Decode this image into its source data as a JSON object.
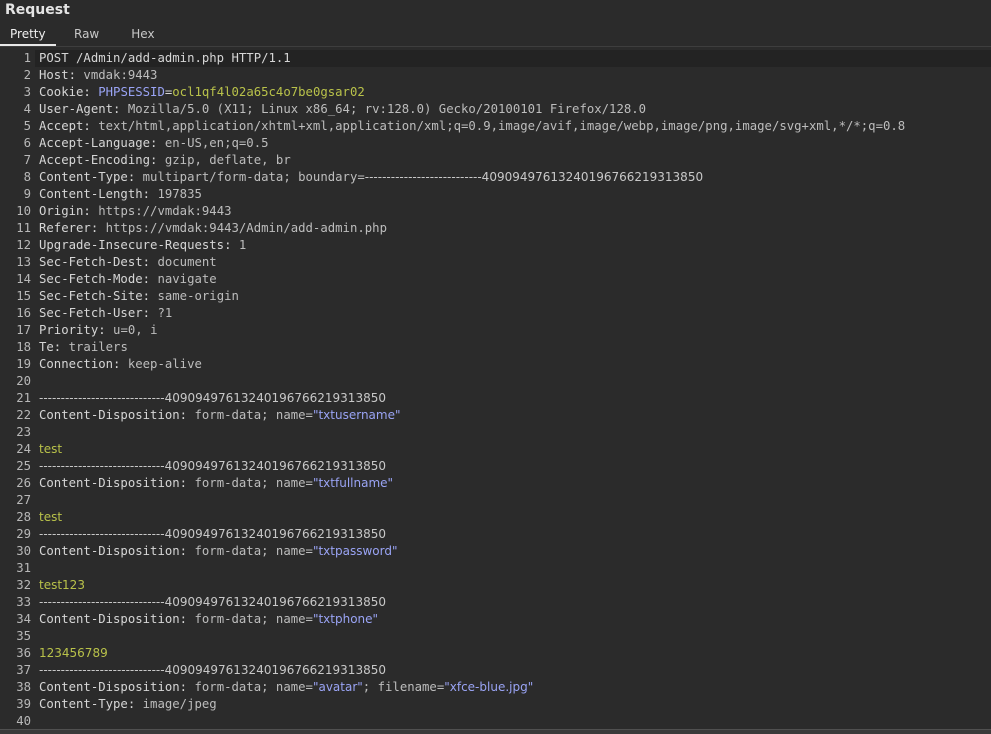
{
  "panel": {
    "title": "Request",
    "tabs": [
      {
        "label": "Pretty",
        "active": true
      },
      {
        "label": "Raw",
        "active": false
      },
      {
        "label": "Hex",
        "active": false
      }
    ]
  },
  "colors": {
    "background": "#2b2b2b",
    "header_name": "#d6d6d6",
    "cookie_name": "#9aa4f5",
    "cookie_value": "#b9c24a",
    "quoted_value": "#9aa4f5",
    "body_value": "#b9c24a"
  },
  "request": {
    "lines": [
      {
        "n": "1",
        "segs": [
          {
            "t": "POST /Admin/add-admin.php HTTP/1.1",
            "c": "hname"
          }
        ]
      },
      {
        "n": "2",
        "segs": [
          {
            "t": "Host: ",
            "c": "hname"
          },
          {
            "t": "vmdak:9443",
            "c": "hval"
          }
        ]
      },
      {
        "n": "3",
        "segs": [
          {
            "t": "Cookie: ",
            "c": "hname"
          },
          {
            "t": "PHPSESSID",
            "c": "cname"
          },
          {
            "t": "=",
            "c": "hname"
          },
          {
            "t": "ocl1qf4l02a65c4o7be0gsar02",
            "c": "cval"
          }
        ]
      },
      {
        "n": "4",
        "segs": [
          {
            "t": "User-Agent: ",
            "c": "hname"
          },
          {
            "t": "Mozilla/5.0 (X11; Linux x86_64; rv:128.0) Gecko/20100101 Firefox/128.0",
            "c": "hval"
          }
        ]
      },
      {
        "n": "5",
        "segs": [
          {
            "t": "Accept: ",
            "c": "hname"
          },
          {
            "t": "text/html,application/xhtml+xml,application/xml;q=0.9,image/avif,image/webp,image/png,image/svg+xml,*/*;q=0.8",
            "c": "hval"
          }
        ]
      },
      {
        "n": "6",
        "segs": [
          {
            "t": "Accept-Language: ",
            "c": "hname"
          },
          {
            "t": "en-US,en;q=0.5",
            "c": "hval"
          }
        ]
      },
      {
        "n": "7",
        "segs": [
          {
            "t": "Accept-Encoding: ",
            "c": "hname"
          },
          {
            "t": "gzip, deflate, br",
            "c": "hval"
          }
        ]
      },
      {
        "n": "8",
        "segs": [
          {
            "t": "Content-Type: ",
            "c": "hname"
          },
          {
            "t": "multipart/form-data; boundary=",
            "c": "hval"
          },
          {
            "t": "---------------------------409094976132401967662193138­50",
            "c": "boundary"
          }
        ]
      },
      {
        "n": "9",
        "segs": [
          {
            "t": "Content-Length: ",
            "c": "hname"
          },
          {
            "t": "197835",
            "c": "hval"
          }
        ]
      },
      {
        "n": "10",
        "segs": [
          {
            "t": "Origin: ",
            "c": "hname"
          },
          {
            "t": "https://vmdak:9443",
            "c": "hval"
          }
        ]
      },
      {
        "n": "11",
        "segs": [
          {
            "t": "Referer: ",
            "c": "hname"
          },
          {
            "t": "https://vmdak:9443/Admin/add-admin.php",
            "c": "hval"
          }
        ]
      },
      {
        "n": "12",
        "segs": [
          {
            "t": "Upgrade-Insecure-Requests: ",
            "c": "hname"
          },
          {
            "t": "1",
            "c": "hval"
          }
        ]
      },
      {
        "n": "13",
        "segs": [
          {
            "t": "Sec-Fetch-Dest: ",
            "c": "hname"
          },
          {
            "t": "document",
            "c": "hval"
          }
        ]
      },
      {
        "n": "14",
        "segs": [
          {
            "t": "Sec-Fetch-Mode: ",
            "c": "hname"
          },
          {
            "t": "navigate",
            "c": "hval"
          }
        ]
      },
      {
        "n": "15",
        "segs": [
          {
            "t": "Sec-Fetch-Site: ",
            "c": "hname"
          },
          {
            "t": "same-origin",
            "c": "hval"
          }
        ]
      },
      {
        "n": "16",
        "segs": [
          {
            "t": "Sec-Fetch-User: ",
            "c": "hname"
          },
          {
            "t": "?1",
            "c": "hval"
          }
        ]
      },
      {
        "n": "17",
        "segs": [
          {
            "t": "Priority: ",
            "c": "hname"
          },
          {
            "t": "u=0, i",
            "c": "hval"
          }
        ]
      },
      {
        "n": "18",
        "segs": [
          {
            "t": "Te: ",
            "c": "hname"
          },
          {
            "t": "trailers",
            "c": "hval"
          }
        ]
      },
      {
        "n": "19",
        "segs": [
          {
            "t": "Connection: ",
            "c": "hname"
          },
          {
            "t": "keep-alive",
            "c": "hval"
          }
        ]
      },
      {
        "n": "20",
        "segs": []
      },
      {
        "n": "21",
        "segs": [
          {
            "t": "-----------------------------40909497613240196766219313850",
            "c": "boundary"
          }
        ]
      },
      {
        "n": "22",
        "segs": [
          {
            "t": "Content-Disposition: ",
            "c": "hname"
          },
          {
            "t": "form-data; name=",
            "c": "hval"
          },
          {
            "t": "\"txtusername\"",
            "c": "qval"
          }
        ]
      },
      {
        "n": "23",
        "segs": []
      },
      {
        "n": "24",
        "segs": [
          {
            "t": "test",
            "c": "bodyval"
          }
        ]
      },
      {
        "n": "25",
        "segs": [
          {
            "t": "-----------------------------40909497613240196766219313850",
            "c": "boundary"
          }
        ]
      },
      {
        "n": "26",
        "segs": [
          {
            "t": "Content-Disposition: ",
            "c": "hname"
          },
          {
            "t": "form-data; name=",
            "c": "hval"
          },
          {
            "t": "\"txtfullname\"",
            "c": "qval"
          }
        ]
      },
      {
        "n": "27",
        "segs": []
      },
      {
        "n": "28",
        "segs": [
          {
            "t": "test",
            "c": "bodyval"
          }
        ]
      },
      {
        "n": "29",
        "segs": [
          {
            "t": "-----------------------------40909497613240196766219313850",
            "c": "boundary"
          }
        ]
      },
      {
        "n": "30",
        "segs": [
          {
            "t": "Content-Disposition: ",
            "c": "hname"
          },
          {
            "t": "form-data; name=",
            "c": "hval"
          },
          {
            "t": "\"txtpassword\"",
            "c": "qval"
          }
        ]
      },
      {
        "n": "31",
        "segs": []
      },
      {
        "n": "32",
        "segs": [
          {
            "t": "test123",
            "c": "bodyval"
          }
        ]
      },
      {
        "n": "33",
        "segs": [
          {
            "t": "-----------------------------40909497613240196766219313850",
            "c": "boundary"
          }
        ]
      },
      {
        "n": "34",
        "segs": [
          {
            "t": "Content-Disposition: ",
            "c": "hname"
          },
          {
            "t": "form-data; name=",
            "c": "hval"
          },
          {
            "t": "\"txtphone\"",
            "c": "qval"
          }
        ]
      },
      {
        "n": "35",
        "segs": []
      },
      {
        "n": "36",
        "segs": [
          {
            "t": "123456789",
            "c": "bodyval"
          }
        ]
      },
      {
        "n": "37",
        "segs": [
          {
            "t": "-----------------------------40909497613240196766219313850",
            "c": "boundary"
          }
        ]
      },
      {
        "n": "38",
        "segs": [
          {
            "t": "Content-Disposition: ",
            "c": "hname"
          },
          {
            "t": "form-data; name=",
            "c": "hval"
          },
          {
            "t": "\"avatar\"",
            "c": "qval"
          },
          {
            "t": "; filename=",
            "c": "hval"
          },
          {
            "t": "\"xfce-blue.jpg\"",
            "c": "qval"
          }
        ]
      },
      {
        "n": "39",
        "segs": [
          {
            "t": "Content-Type: ",
            "c": "hname"
          },
          {
            "t": "image/jpeg",
            "c": "hval"
          }
        ]
      },
      {
        "n": "40",
        "segs": []
      }
    ]
  }
}
